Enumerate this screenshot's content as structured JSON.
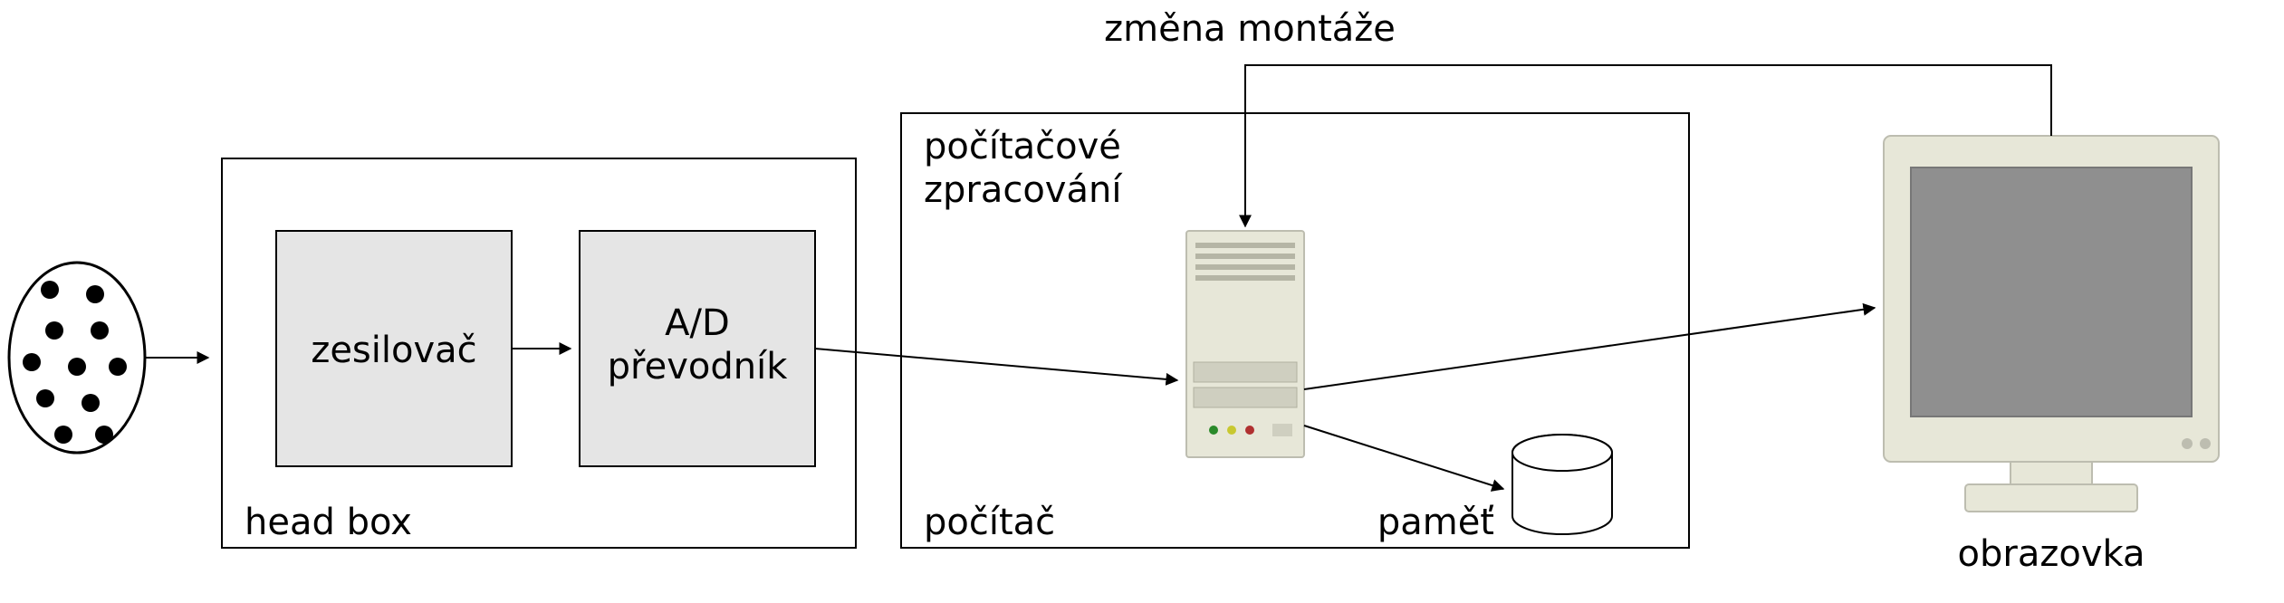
{
  "title_top": "změna montáže",
  "headbox": {
    "caption": "head box",
    "amp": "zesilovač",
    "adc_line1": "A/D",
    "adc_line2": "převodník"
  },
  "computer": {
    "caption": "počítač",
    "processing_line1": "počítačové",
    "processing_line2": "zpracování"
  },
  "memory": "paměť",
  "monitor": "obrazovka"
}
